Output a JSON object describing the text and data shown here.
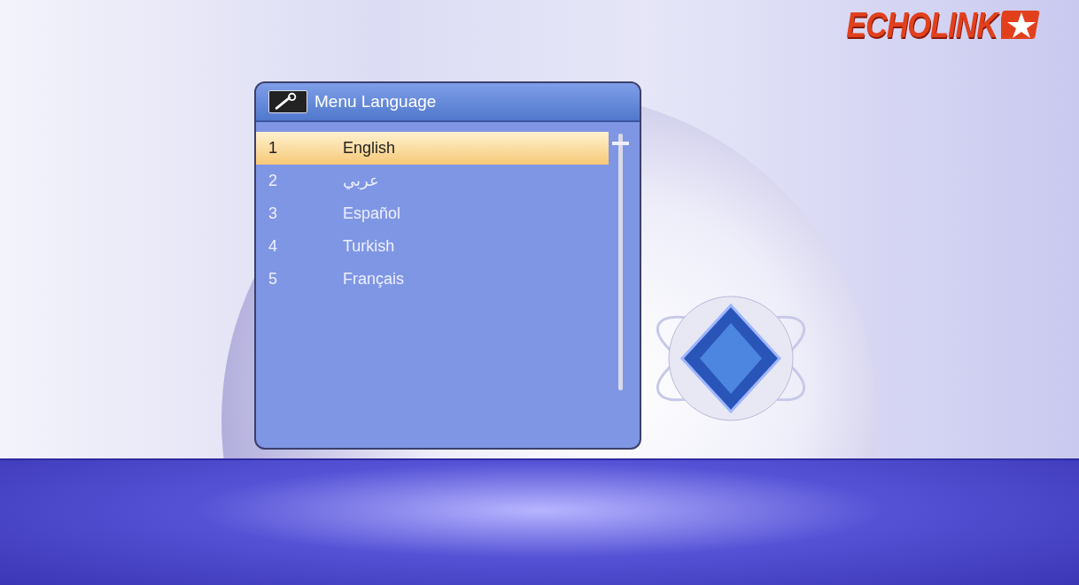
{
  "logo": {
    "text": "ECHOLINK"
  },
  "dialog": {
    "title": "Menu Language",
    "items": [
      {
        "number": "1",
        "label": "English",
        "selected": true
      },
      {
        "number": "2",
        "label": "عربي",
        "selected": false
      },
      {
        "number": "3",
        "label": "Español",
        "selected": false
      },
      {
        "number": "4",
        "label": "Turkish",
        "selected": false
      },
      {
        "number": "5",
        "label": "Français",
        "selected": false
      }
    ]
  }
}
